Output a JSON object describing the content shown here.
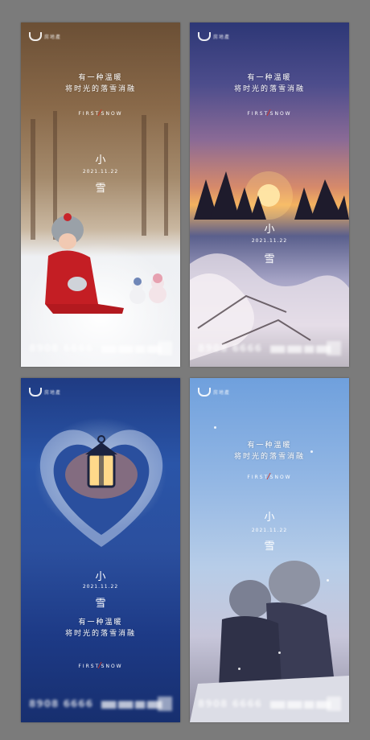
{
  "logo_text": "房地產",
  "tagline_line1": "有一种温暖",
  "tagline_line2": "将时光的落雪消融",
  "first_snow_left": "FIRST",
  "first_snow_right": "SNOW",
  "title_top": "小",
  "date": "2021.11.22",
  "title_bottom": "雪",
  "phone": "8908 6666",
  "contact": "███ ███ ██ ███",
  "colors": {
    "accent_slash": "#d9301f",
    "page_bg": "#7b7b7b"
  }
}
